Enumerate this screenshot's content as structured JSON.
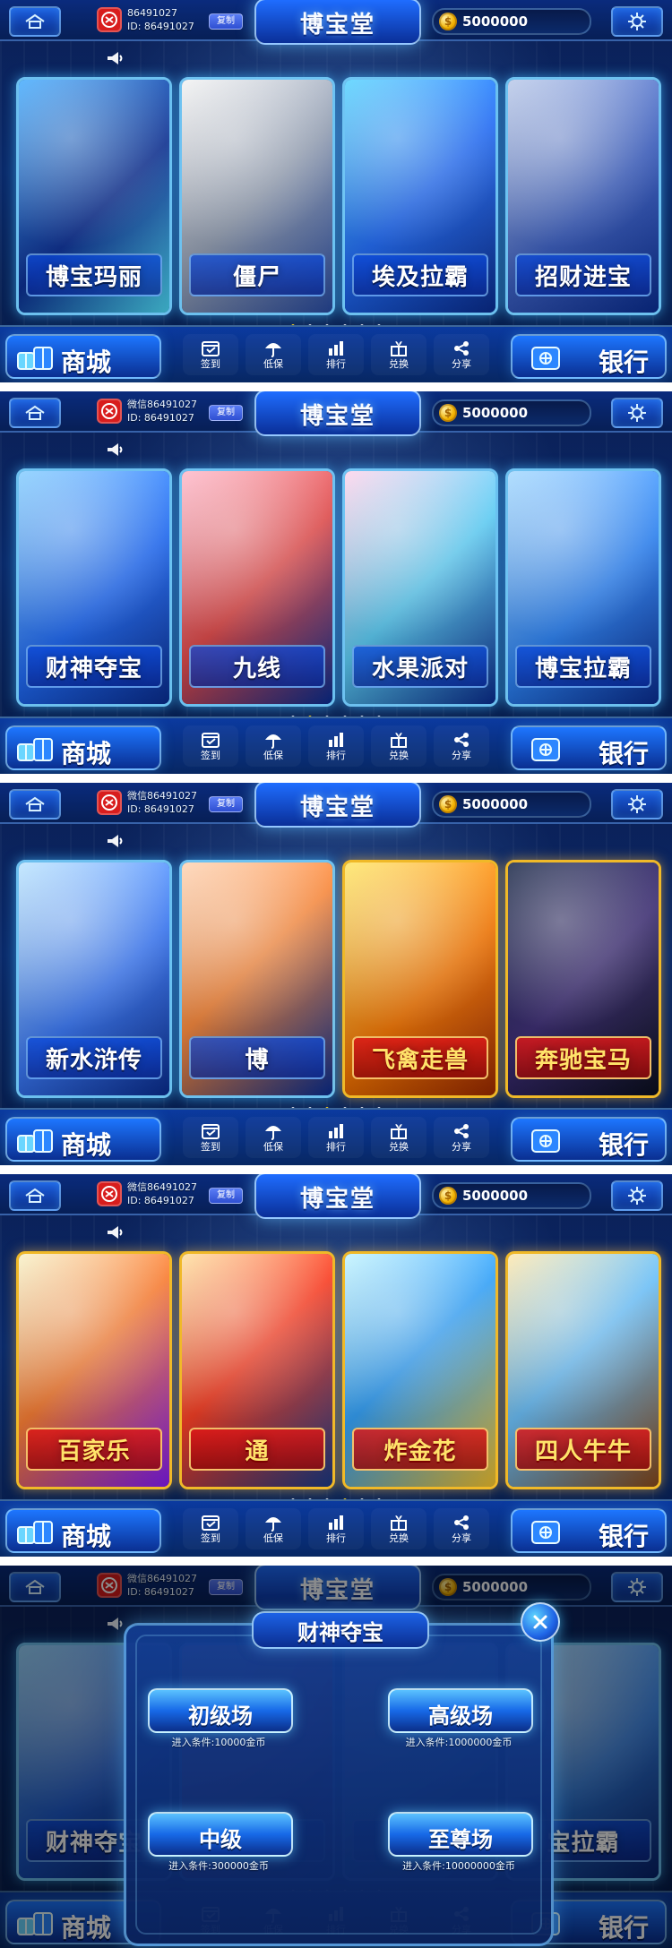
{
  "header": {
    "title": "博宝堂",
    "copy_label": "复制",
    "id_line": "ID: 86491027",
    "coins": "5000000"
  },
  "panels": [
    {
      "profile_line1": "86491027",
      "cards": [
        {
          "label": "博宝玛丽",
          "art": "anime-bikini-girl",
          "style": "blue"
        },
        {
          "label": "僵尸",
          "art": "anime-maid-girl",
          "style": "blue"
        },
        {
          "label": "埃及拉霸",
          "art": "anime-swimsuit-girl",
          "style": "blue"
        },
        {
          "label": "招财进宝",
          "art": "anime-bikini-girl",
          "style": "blue"
        }
      ],
      "active_dot": 0
    },
    {
      "profile_line1": "微信86491027",
      "cards": [
        {
          "label": "财神夺宝",
          "art": "anime-school-girl",
          "style": "blue"
        },
        {
          "label": "九线",
          "art": "anime-bikini-girl",
          "style": "blue"
        },
        {
          "label": "水果派对",
          "art": "anime-swimsuit-girl",
          "style": "blue"
        },
        {
          "label": "博宝拉霸",
          "art": "anime-bikini-girl",
          "style": "blue"
        }
      ],
      "active_dot": 1
    },
    {
      "profile_line1": "微信86491027",
      "cards": [
        {
          "label": "新水浒传",
          "art": "anime-twin-tail-girl",
          "style": "blue"
        },
        {
          "label": "博",
          "art": "anime-bikini-girl",
          "style": "blue"
        },
        {
          "label": "飞禽走兽",
          "art": "cartoon-animals",
          "style": "gold"
        },
        {
          "label": "奔驰宝马",
          "art": "car-logos",
          "style": "gold"
        }
      ],
      "active_dot": 2
    },
    {
      "profile_line1": "微信86491027",
      "cards": [
        {
          "label": "百家乐",
          "art": "casino-girl",
          "style": "gold"
        },
        {
          "label": "通",
          "art": "bull-character",
          "style": "gold"
        },
        {
          "label": "炸金花",
          "art": "cards-chips",
          "style": "gold"
        },
        {
          "label": "四人牛牛",
          "art": "bull-cowboy",
          "style": "gold"
        }
      ],
      "active_dot": 3
    },
    {
      "profile_line1": "微信86491027",
      "cards": [
        {
          "label": "财神夺宝",
          "art": "anime-school-girl",
          "style": "blue"
        },
        {
          "label": "",
          "art": "anime-bikini-girl",
          "style": "blue"
        },
        {
          "label": "",
          "art": "anime-swimsuit-girl",
          "style": "blue"
        },
        {
          "label": "宝拉霸",
          "art": "anime-bikini-girl",
          "style": "blue"
        }
      ],
      "active_dot": 1,
      "modal": {
        "title": "财神夺宝",
        "rooms": [
          {
            "label": "初级场",
            "requirement": "进入条件:10000金币"
          },
          {
            "label": "高级场",
            "requirement": "进入条件:1000000金币"
          },
          {
            "label": "中级",
            "requirement": "进入条件:300000金币"
          },
          {
            "label": "至尊场",
            "requirement": "进入条件:10000000金币"
          }
        ]
      }
    }
  ],
  "bottom": {
    "shop": "商城",
    "bank": "银行",
    "nav": [
      {
        "label": "签到",
        "icon": "calendar-icon"
      },
      {
        "label": "低保",
        "icon": "umbrella-icon"
      },
      {
        "label": "排行",
        "icon": "bar-chart-icon"
      },
      {
        "label": "兑换",
        "icon": "gift-icon"
      },
      {
        "label": "分享",
        "icon": "share-icon"
      }
    ]
  },
  "pager": {
    "count": 6
  },
  "colors": {
    "primary_blue": "#0a2f98",
    "highlight_blue": "#5ac2ff",
    "accent_gold": "#f6d21a",
    "red": "#d81d1d"
  }
}
